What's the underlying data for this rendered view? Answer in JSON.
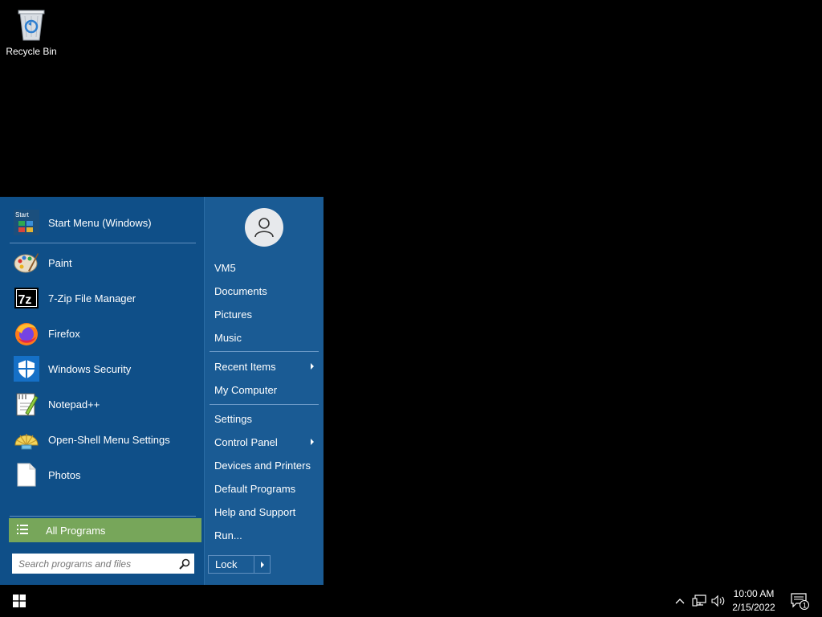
{
  "desktop": {
    "icons": [
      {
        "label": "Recycle Bin",
        "icon": "recycle-bin-icon"
      }
    ]
  },
  "start_menu": {
    "programs": [
      {
        "label": "Start Menu (Windows)",
        "icon": "start-menu-icon"
      },
      {
        "label": "Paint",
        "icon": "paint-icon"
      },
      {
        "label": "7-Zip File Manager",
        "icon": "7zip-icon"
      },
      {
        "label": "Firefox",
        "icon": "firefox-icon"
      },
      {
        "label": "Windows Security",
        "icon": "shield-icon"
      },
      {
        "label": "Notepad++",
        "icon": "notepadpp-icon"
      },
      {
        "label": "Open-Shell Menu Settings",
        "icon": "shell-icon"
      },
      {
        "label": "Photos",
        "icon": "photos-icon"
      }
    ],
    "start_icon_text": "Start",
    "sevenzip_icon_text": "7z",
    "all_programs": "All Programs",
    "search": {
      "placeholder": "Search programs and files"
    },
    "right_items": [
      {
        "label": "VM5"
      },
      {
        "label": "Documents"
      },
      {
        "label": "Pictures"
      },
      {
        "label": "Music"
      },
      {
        "label": "Recent Items",
        "submenu": true
      },
      {
        "label": "My Computer"
      },
      {
        "label": "Settings"
      },
      {
        "label": "Control Panel",
        "submenu": true
      },
      {
        "label": "Devices and Printers"
      },
      {
        "label": "Default Programs"
      },
      {
        "label": "Help and Support"
      },
      {
        "label": "Run..."
      }
    ],
    "lock_label": "Lock"
  },
  "taskbar": {
    "clock": {
      "time": "10:00 AM",
      "date": "2/15/2022"
    },
    "notification_count": "1",
    "tray_icons": [
      "chevron-up-icon",
      "network-icon",
      "volume-icon"
    ]
  },
  "colors": {
    "menu_left": "#0f4f88",
    "menu_right": "#1a5b94",
    "all_programs": "#77a65a"
  }
}
